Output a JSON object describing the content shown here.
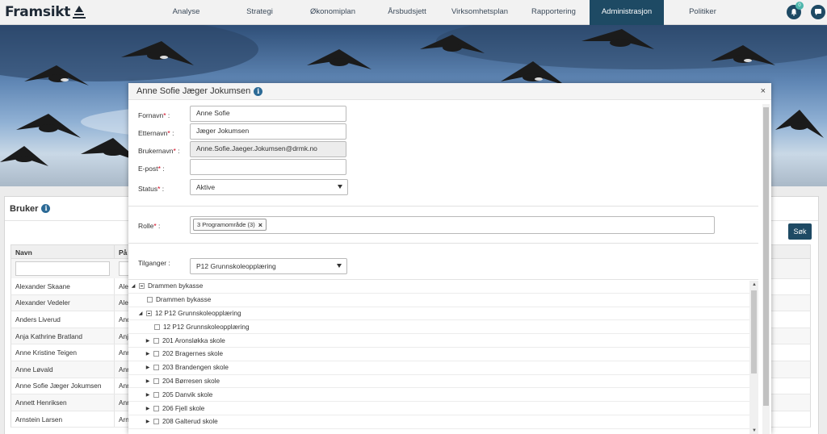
{
  "brand": {
    "name": "Framsikt"
  },
  "nav": {
    "tabs": [
      {
        "label": "Analyse"
      },
      {
        "label": "Strategi"
      },
      {
        "label": "Økonomiplan"
      },
      {
        "label": "Årsbudsjett"
      },
      {
        "label": "Virksomhetsplan"
      },
      {
        "label": "Rapportering"
      },
      {
        "label": "Administrasjon",
        "active": true
      },
      {
        "label": "Politiker"
      }
    ],
    "notification_count": "0"
  },
  "bruker_panel": {
    "title": "Bruker",
    "search_button": "Søk",
    "columns": [
      "Navn",
      "På"
    ],
    "rows": [
      {
        "name": "Alexander Skaane",
        "col2": "Ale"
      },
      {
        "name": "Alexander Vedeler",
        "col2": "Ale"
      },
      {
        "name": "Anders Liverud",
        "col2": "And"
      },
      {
        "name": "Anja Kathrine Bratland",
        "col2": "Anj"
      },
      {
        "name": "Anne Kristine Teigen",
        "col2": "Ann"
      },
      {
        "name": "Anne Løvald",
        "col2": "Ann"
      },
      {
        "name": "Anne Sofie Jæger Jokumsen",
        "col2": "Ann"
      },
      {
        "name": "Annett Henriksen",
        "col2": "Ann"
      },
      {
        "name": "Arnstein Larsen",
        "col2": "Arn"
      }
    ]
  },
  "modal": {
    "title": "Anne Sofie Jæger Jokumsen",
    "close": "×",
    "fields": {
      "fornavn": {
        "label": "Fornavn",
        "value": "Anne Sofie"
      },
      "etternavn": {
        "label": "Etternavn",
        "value": "Jæger Jokumsen"
      },
      "brukernavn": {
        "label": "Brukernavn",
        "value": "Anne.Sofie.Jaeger.Jokumsen@drmk.no"
      },
      "epost": {
        "label": "E-post",
        "value": ""
      },
      "status": {
        "label": "Status",
        "value": "Aktive"
      },
      "rolle": {
        "label": "Rolle",
        "chip": "3 Programområde (3)"
      },
      "tilganger": {
        "label": "Tilganger :",
        "value": "P12 Grunnskoleopplæring"
      }
    },
    "tree": [
      {
        "label": "Drammen bykasse",
        "level": 0,
        "arrow": "down",
        "check": "partial"
      },
      {
        "label": "Drammen bykasse",
        "level": 1,
        "arrow": "none",
        "check": "empty"
      },
      {
        "label": "12 P12 Grunnskoleopplæring",
        "level": 1,
        "arrow": "down",
        "check": "partial"
      },
      {
        "label": "12 P12 Grunnskoleopplæring",
        "level": 2,
        "arrow": "none",
        "check": "empty"
      },
      {
        "label": "201 Aronsløkka skole",
        "level": 2,
        "arrow": "right",
        "check": "empty"
      },
      {
        "label": "202 Bragernes skole",
        "level": 2,
        "arrow": "right",
        "check": "empty"
      },
      {
        "label": "203 Brandengen skole",
        "level": 2,
        "arrow": "right",
        "check": "empty"
      },
      {
        "label": "204 Børresen skole",
        "level": 2,
        "arrow": "right",
        "check": "empty"
      },
      {
        "label": "205 Danvik skole",
        "level": 2,
        "arrow": "right",
        "check": "empty"
      },
      {
        "label": "206 Fjell skole",
        "level": 2,
        "arrow": "right",
        "check": "empty"
      },
      {
        "label": "208 Galterud skole",
        "level": 2,
        "arrow": "right",
        "check": "empty"
      }
    ]
  },
  "colors": {
    "primary": "#1e4a64",
    "required": "#d0021b",
    "badge": "#4db6ac"
  }
}
